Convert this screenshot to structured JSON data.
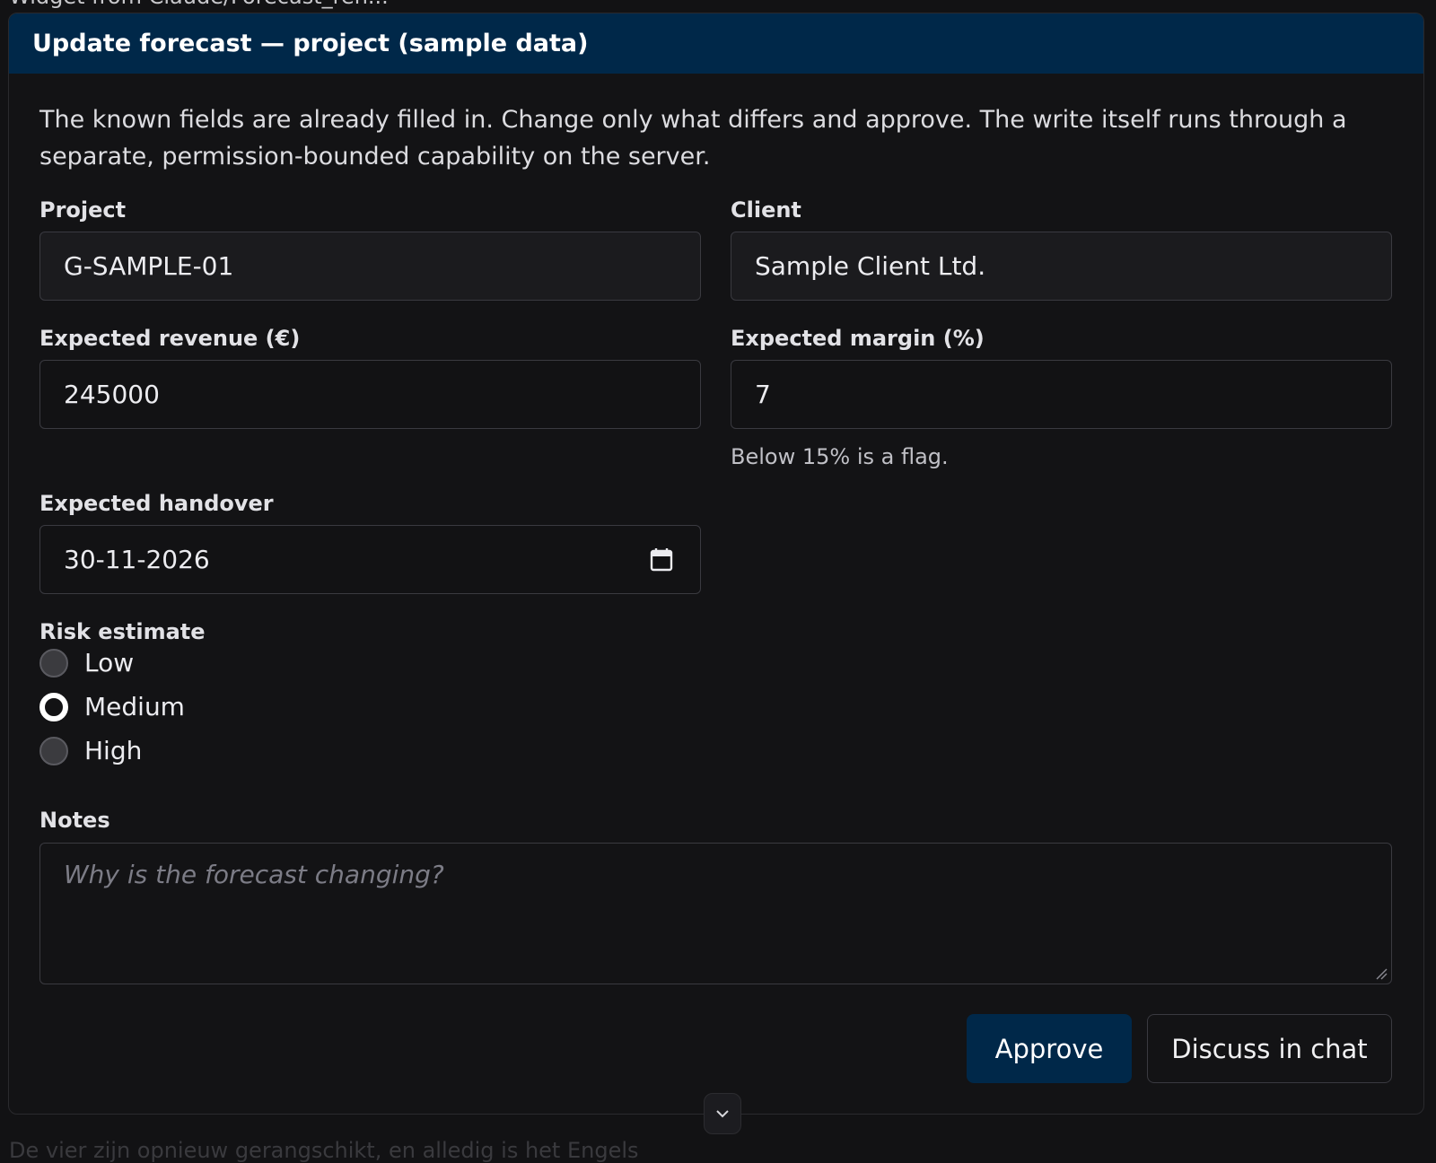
{
  "background_text": {
    "top": "Widget from Claude/Forecast_ren...",
    "bottom": "De vier zijn opnieuw gerangschikt, en alledig is het Engels"
  },
  "dialog": {
    "title": "Update forecast — project (sample data)",
    "intro": "The known fields are already filled in. Change only what differs and approve. The write itself runs through a separate, permission-bounded capability on the server.",
    "fields": {
      "project": {
        "label": "Project",
        "value": "G-SAMPLE-01"
      },
      "client": {
        "label": "Client",
        "value": "Sample Client Ltd."
      },
      "revenue": {
        "label": "Expected revenue (€)",
        "value": "245000"
      },
      "margin": {
        "label": "Expected margin (%)",
        "value": "7",
        "hint": "Below 15% is a flag."
      },
      "handover": {
        "label": "Expected handover",
        "value": "30-11-2026",
        "icon": "calendar-icon"
      }
    },
    "risk": {
      "label": "Risk estimate",
      "options": [
        "Low",
        "Medium",
        "High"
      ],
      "selected": "Medium"
    },
    "notes": {
      "label": "Notes",
      "placeholder": "Why is the forecast changing?"
    },
    "buttons": {
      "approve": "Approve",
      "discuss": "Discuss in chat"
    },
    "scroll_icon": "chevron-down-icon"
  },
  "colors": {
    "header": "#002849",
    "approve_bg": "#002849",
    "background": "#121214"
  }
}
